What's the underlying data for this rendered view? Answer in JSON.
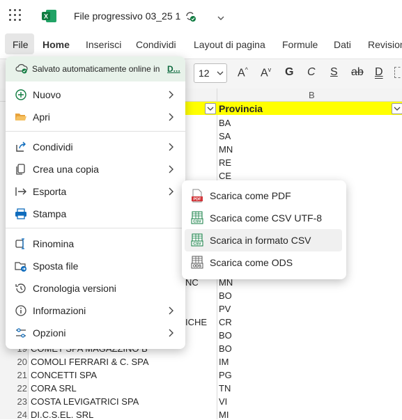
{
  "app": {
    "doc_title": "File progressivo 03_25 1"
  },
  "menubar": {
    "file": "File",
    "home": "Home",
    "inserisci": "Inserisci",
    "condividi": "Condividi",
    "layout": "Layout di pagina",
    "formule": "Formule",
    "dati": "Dati",
    "revisione": "Revision"
  },
  "ribbon": {
    "font_size": "12"
  },
  "grid": {
    "column_b": "B",
    "header_provincia": "Provincia",
    "provinces": [
      "BA",
      "SA",
      "MN",
      "RE",
      "CE",
      "MN",
      "BO",
      "PV",
      "CR",
      "BO",
      "BO",
      "IM",
      "PG",
      "TN",
      "VI",
      "MI"
    ],
    "partial_a": [
      "NC",
      "ICHE"
    ],
    "rows": [
      {
        "num": "19",
        "name": "COMET SPA MAGAZZINO B"
      },
      {
        "num": "20",
        "name": "COMOLI FERRARI & C. SPA"
      },
      {
        "num": "21",
        "name": "CONCETTI SPA"
      },
      {
        "num": "22",
        "name": "CORA SRL"
      },
      {
        "num": "23",
        "name": "COSTA LEVIGATRICI SPA"
      },
      {
        "num": "24",
        "name": "DI.C.S.EL. SRL"
      }
    ]
  },
  "file_menu": {
    "saved_text": "Salvato automaticamente online in",
    "saved_link": "D...",
    "items": {
      "nuovo": "Nuovo",
      "apri": "Apri",
      "condividi": "Condividi",
      "crea_copia": "Crea una copia",
      "esporta": "Esporta",
      "stampa": "Stampa",
      "rinomina": "Rinomina",
      "sposta": "Sposta file",
      "cronologia": "Cronologia versioni",
      "informazioni": "Informazioni",
      "opzioni": "Opzioni"
    }
  },
  "export_submenu": {
    "pdf": "Scarica come PDF",
    "csv_utf8": "Scarica come CSV UTF-8",
    "csv": "Scarica in formato CSV",
    "ods": "Scarica come ODS",
    "icon_labels": {
      "pdf": "PDF",
      "csv": "CSV",
      "ods": "ODS"
    }
  },
  "colors": {
    "excel_green": "#107c41",
    "header_yellow": "#ffff00",
    "saved_bg": "#e8f2ea",
    "pdf_red": "#d13438"
  }
}
